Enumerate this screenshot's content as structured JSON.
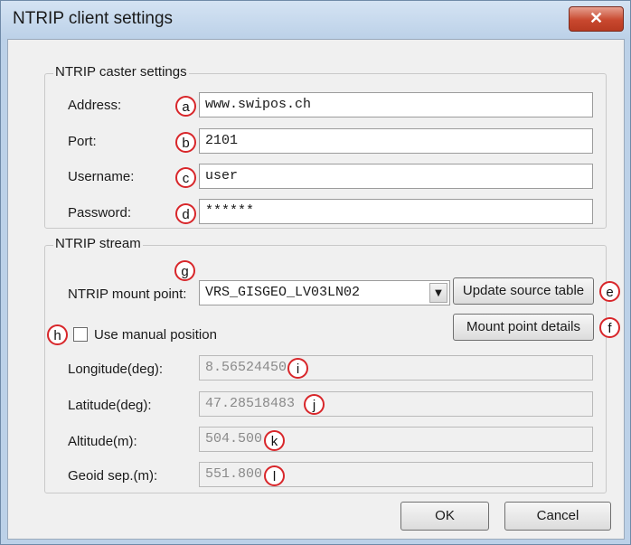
{
  "window": {
    "title": "NTRIP client settings",
    "close_glyph": "✕"
  },
  "caster": {
    "group_title": "NTRIP caster settings",
    "address": {
      "label": "Address:",
      "value": "www.swipos.ch",
      "marker": "a"
    },
    "port": {
      "label": "Port:",
      "value": "2101",
      "marker": "b"
    },
    "username": {
      "label": "Username:",
      "value": "user",
      "marker": "c"
    },
    "password": {
      "label": "Password:",
      "value": "******",
      "marker": "d"
    }
  },
  "stream": {
    "group_title": "NTRIP stream",
    "mount_point": {
      "label": "NTRIP mount point:",
      "value": "VRS_GISGEO_LV03LN02",
      "marker": "g",
      "arrow": "▼"
    },
    "update_button": {
      "label": "Update source table",
      "marker": "e"
    },
    "details_button": {
      "label": "Mount point details",
      "marker": "f"
    },
    "manual_position": {
      "label": "Use manual position",
      "checked": false,
      "marker": "h"
    },
    "longitude": {
      "label": "Longitude(deg):",
      "value": "8.56524450",
      "marker": "i"
    },
    "latitude": {
      "label": "Latitude(deg):",
      "value": "47.28518483",
      "marker": "j"
    },
    "altitude": {
      "label": "Altitude(m):",
      "value": "504.500",
      "marker": "k"
    },
    "geoid": {
      "label": "Geoid sep.(m):",
      "value": "551.800",
      "marker": "l"
    }
  },
  "footer": {
    "ok_label": "OK",
    "cancel_label": "Cancel"
  },
  "colors": {
    "marker_ring": "#d8262a",
    "close_button": "#c8482e"
  }
}
